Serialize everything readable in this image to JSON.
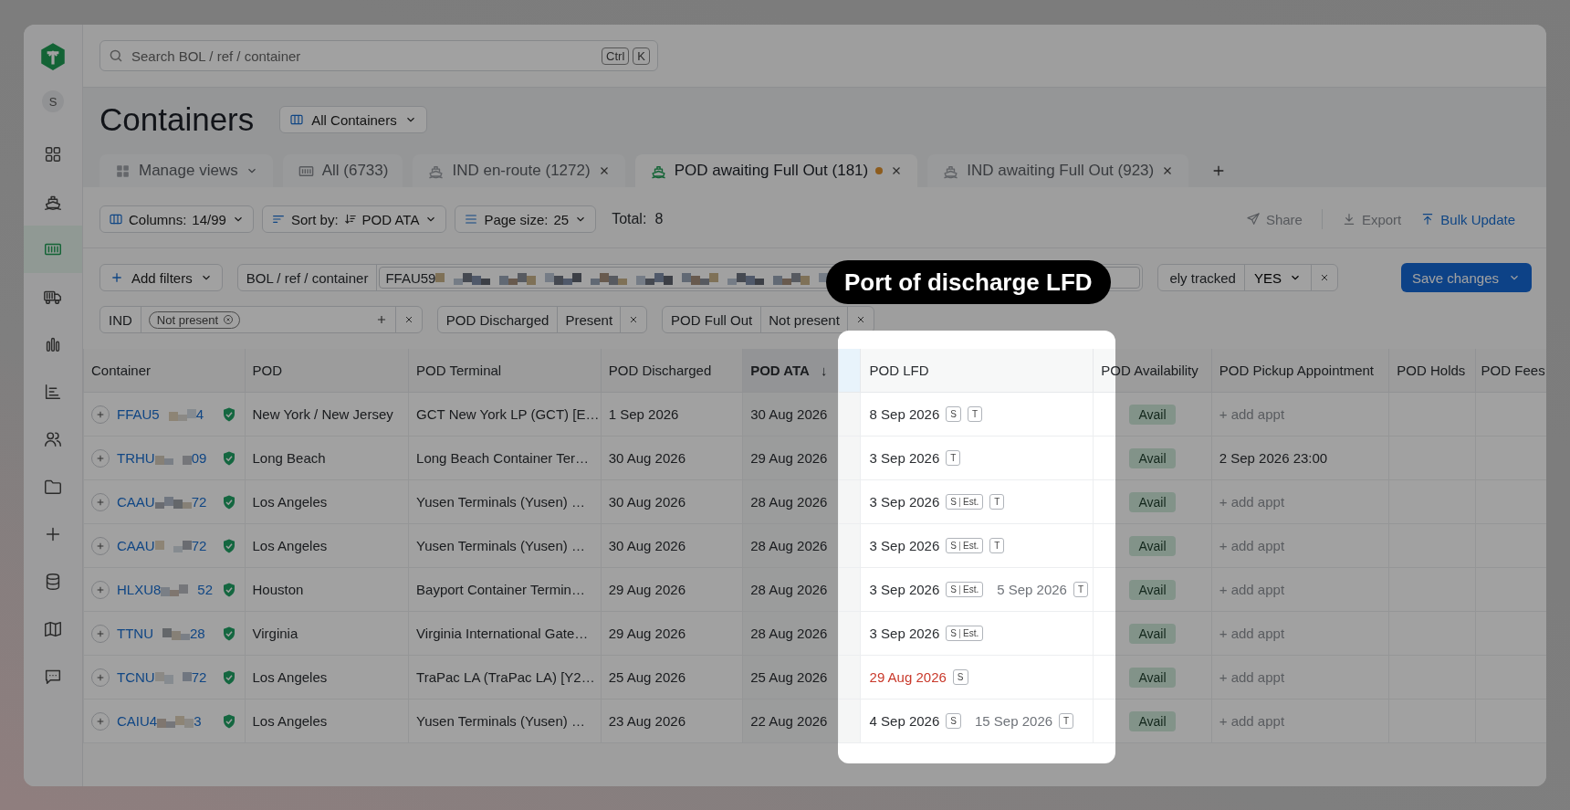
{
  "sidebar": {
    "avatar": "S",
    "items": [
      {
        "kind": "dashboard",
        "selected": false
      },
      {
        "kind": "ship",
        "selected": false
      },
      {
        "kind": "container",
        "selected": true
      },
      {
        "kind": "truck",
        "selected": false
      },
      {
        "kind": "bars",
        "selected": false
      },
      {
        "kind": "report",
        "selected": false
      },
      {
        "kind": "people",
        "selected": false
      },
      {
        "kind": "folder",
        "selected": false
      },
      {
        "kind": "add",
        "selected": false
      },
      {
        "kind": "database",
        "selected": false
      },
      {
        "kind": "map",
        "selected": false
      },
      {
        "kind": "chat",
        "selected": false
      }
    ]
  },
  "search": {
    "placeholder": "Search BOL / ref / container",
    "keys": [
      "Ctrl",
      "K"
    ]
  },
  "page": {
    "title": "Containers",
    "view": "All Containers"
  },
  "tabs": [
    {
      "kind": "menu",
      "label": "Manage views",
      "selected": false
    },
    {
      "kind": "all",
      "label": "All (6733)",
      "selected": false,
      "closable": false,
      "unsaved": false
    },
    {
      "kind": "view",
      "label": "IND en-route (1272)",
      "selected": false,
      "closable": true,
      "unsaved": false
    },
    {
      "kind": "view",
      "label": "POD awaiting Full Out (181)",
      "selected": true,
      "closable": true,
      "unsaved": true
    },
    {
      "kind": "view",
      "label": "IND awaiting Full Out (923)",
      "selected": false,
      "closable": true,
      "unsaved": false
    }
  ],
  "toolbar": {
    "controls": [
      {
        "kind": "columns",
        "label": "Columns:",
        "value": "14/99"
      },
      {
        "kind": "sort",
        "label": "Sort by:",
        "value": "POD ATA"
      },
      {
        "kind": "page_size",
        "label": "Page size:",
        "value": "25"
      }
    ],
    "total_label": "Total:",
    "total": "8",
    "actions": [
      {
        "kind": "share",
        "label": "Share",
        "primary": false
      },
      {
        "kind": "export",
        "label": "Export",
        "primary": false
      },
      {
        "kind": "bulk",
        "label": "Bulk Update",
        "primary": true
      }
    ]
  },
  "filters": {
    "add": "Add filters",
    "save": "Save changes",
    "rows": [
      [
        {
          "kind": "search",
          "label": "BOL / ref / container",
          "value": "FFAU59"
        },
        {
          "kind": "select",
          "label": "ely tracked",
          "value": "YES"
        }
      ],
      [
        {
          "kind": "tags",
          "label": "IND",
          "tags": [
            "Not present"
          ]
        },
        {
          "kind": "value",
          "label": "POD Discharged",
          "value": "Present"
        },
        {
          "kind": "value",
          "label": "POD Full Out",
          "value": "Not present"
        }
      ]
    ]
  },
  "table": {
    "columns": [
      {
        "kind": "text",
        "label": "Container",
        "sorted": false
      },
      {
        "kind": "text",
        "label": "POD",
        "sorted": false
      },
      {
        "kind": "text",
        "label": "POD Terminal",
        "sorted": false
      },
      {
        "kind": "text",
        "label": "POD Discharged",
        "sorted": false
      },
      {
        "kind": "text",
        "label": "POD ATA",
        "sorted": true,
        "sort_mark": "↓"
      },
      {
        "kind": "spacer"
      },
      {
        "kind": "text",
        "label": "POD LFD",
        "sorted": false
      },
      {
        "kind": "text",
        "label": "POD Availability",
        "sorted": false
      },
      {
        "kind": "text",
        "label": "POD Pickup Appointment",
        "sorted": false
      },
      {
        "kind": "text",
        "label": "POD Holds",
        "sorted": false
      },
      {
        "kind": "text",
        "label": "POD Fees",
        "sorted": false
      }
    ],
    "rows": [
      {
        "container": {
          "start": "FFAU5",
          "end": "4"
        },
        "verified": true,
        "pod": "New York / New Jersey",
        "terminal": "GCT New York LP (GCT) [E…",
        "discharged": "1 Sep 2026",
        "ata": "30 Aug 2026",
        "lfd": [
          {
            "date": "8 Sep 2026",
            "overdue": false,
            "secondary": false,
            "sources": [
              {
                "code": "S"
              },
              {
                "code": "T"
              }
            ]
          }
        ],
        "availability": "Avail",
        "appointment": {
          "kind": "action",
          "text": "+ add appt"
        }
      },
      {
        "container": {
          "start": "TRHU",
          "end": "09"
        },
        "verified": true,
        "pod": "Long Beach",
        "terminal": "Long Beach Container Ter…",
        "discharged": "30 Aug 2026",
        "ata": "29 Aug 2026",
        "lfd": [
          {
            "date": "3 Sep 2026",
            "overdue": false,
            "secondary": false,
            "sources": [
              {
                "code": "T"
              }
            ]
          }
        ],
        "availability": "Avail",
        "appointment": {
          "kind": "value",
          "text": "2 Sep 2026 23:00"
        }
      },
      {
        "container": {
          "start": "CAAU",
          "end": "72"
        },
        "verified": true,
        "pod": "Los Angeles",
        "terminal": "Yusen Terminals (Yusen) …",
        "discharged": "30 Aug 2026",
        "ata": "28 Aug 2026",
        "lfd": [
          {
            "date": "3 Sep 2026",
            "overdue": false,
            "secondary": false,
            "sources": [
              {
                "code": "S",
                "note": "Est."
              },
              {
                "code": "T"
              }
            ]
          }
        ],
        "availability": "Avail",
        "appointment": {
          "kind": "action",
          "text": "+ add appt"
        }
      },
      {
        "container": {
          "start": "CAAU",
          "end": "72"
        },
        "verified": true,
        "pod": "Los Angeles",
        "terminal": "Yusen Terminals (Yusen) …",
        "discharged": "30 Aug 2026",
        "ata": "28 Aug 2026",
        "lfd": [
          {
            "date": "3 Sep 2026",
            "overdue": false,
            "secondary": false,
            "sources": [
              {
                "code": "S",
                "note": "Est."
              },
              {
                "code": "T"
              }
            ]
          }
        ],
        "availability": "Avail",
        "appointment": {
          "kind": "action",
          "text": "+ add appt"
        }
      },
      {
        "container": {
          "start": "HLXU8",
          "end": "52"
        },
        "verified": true,
        "pod": "Houston",
        "terminal": "Bayport Container Termin…",
        "discharged": "29 Aug 2026",
        "ata": "28 Aug 2026",
        "lfd": [
          {
            "date": "3 Sep 2026",
            "overdue": false,
            "secondary": false,
            "sources": [
              {
                "code": "S",
                "note": "Est."
              }
            ]
          },
          {
            "date": "5 Sep 2026",
            "overdue": false,
            "secondary": true,
            "sources": [
              {
                "code": "T"
              }
            ]
          }
        ],
        "availability": "Avail",
        "appointment": {
          "kind": "action",
          "text": "+ add appt"
        }
      },
      {
        "container": {
          "start": "TTNU",
          "end": "28"
        },
        "verified": true,
        "pod": "Virginia",
        "terminal": "Virginia International Gate…",
        "discharged": "29 Aug 2026",
        "ata": "28 Aug 2026",
        "lfd": [
          {
            "date": "3 Sep 2026",
            "overdue": false,
            "secondary": false,
            "sources": [
              {
                "code": "S",
                "note": "Est."
              }
            ]
          }
        ],
        "availability": "Avail",
        "appointment": {
          "kind": "action",
          "text": "+ add appt"
        }
      },
      {
        "container": {
          "start": "TCNU",
          "end": "72"
        },
        "verified": true,
        "pod": "Los Angeles",
        "terminal": "TraPac LA (TraPac LA) [Y2…",
        "discharged": "25 Aug 2026",
        "ata": "25 Aug 2026",
        "lfd": [
          {
            "date": "29 Aug 2026",
            "overdue": true,
            "secondary": false,
            "sources": [
              {
                "code": "S"
              }
            ]
          }
        ],
        "availability": "Avail",
        "appointment": {
          "kind": "action",
          "text": "+ add appt"
        }
      },
      {
        "container": {
          "start": "CAIU4",
          "end": "3"
        },
        "verified": true,
        "pod": "Los Angeles",
        "terminal": "Yusen Terminals (Yusen) …",
        "discharged": "23 Aug 2026",
        "ata": "22 Aug 2026",
        "lfd": [
          {
            "date": "4 Sep 2026",
            "overdue": false,
            "secondary": false,
            "sources": [
              {
                "code": "S"
              }
            ]
          },
          {
            "date": "15 Sep 2026",
            "overdue": false,
            "secondary": true,
            "sources": [
              {
                "code": "T"
              }
            ]
          }
        ],
        "availability": "Avail",
        "appointment": {
          "kind": "action",
          "text": "+ add appt"
        }
      }
    ]
  },
  "tooltip": {
    "text": "Port of discharge LFD"
  }
}
